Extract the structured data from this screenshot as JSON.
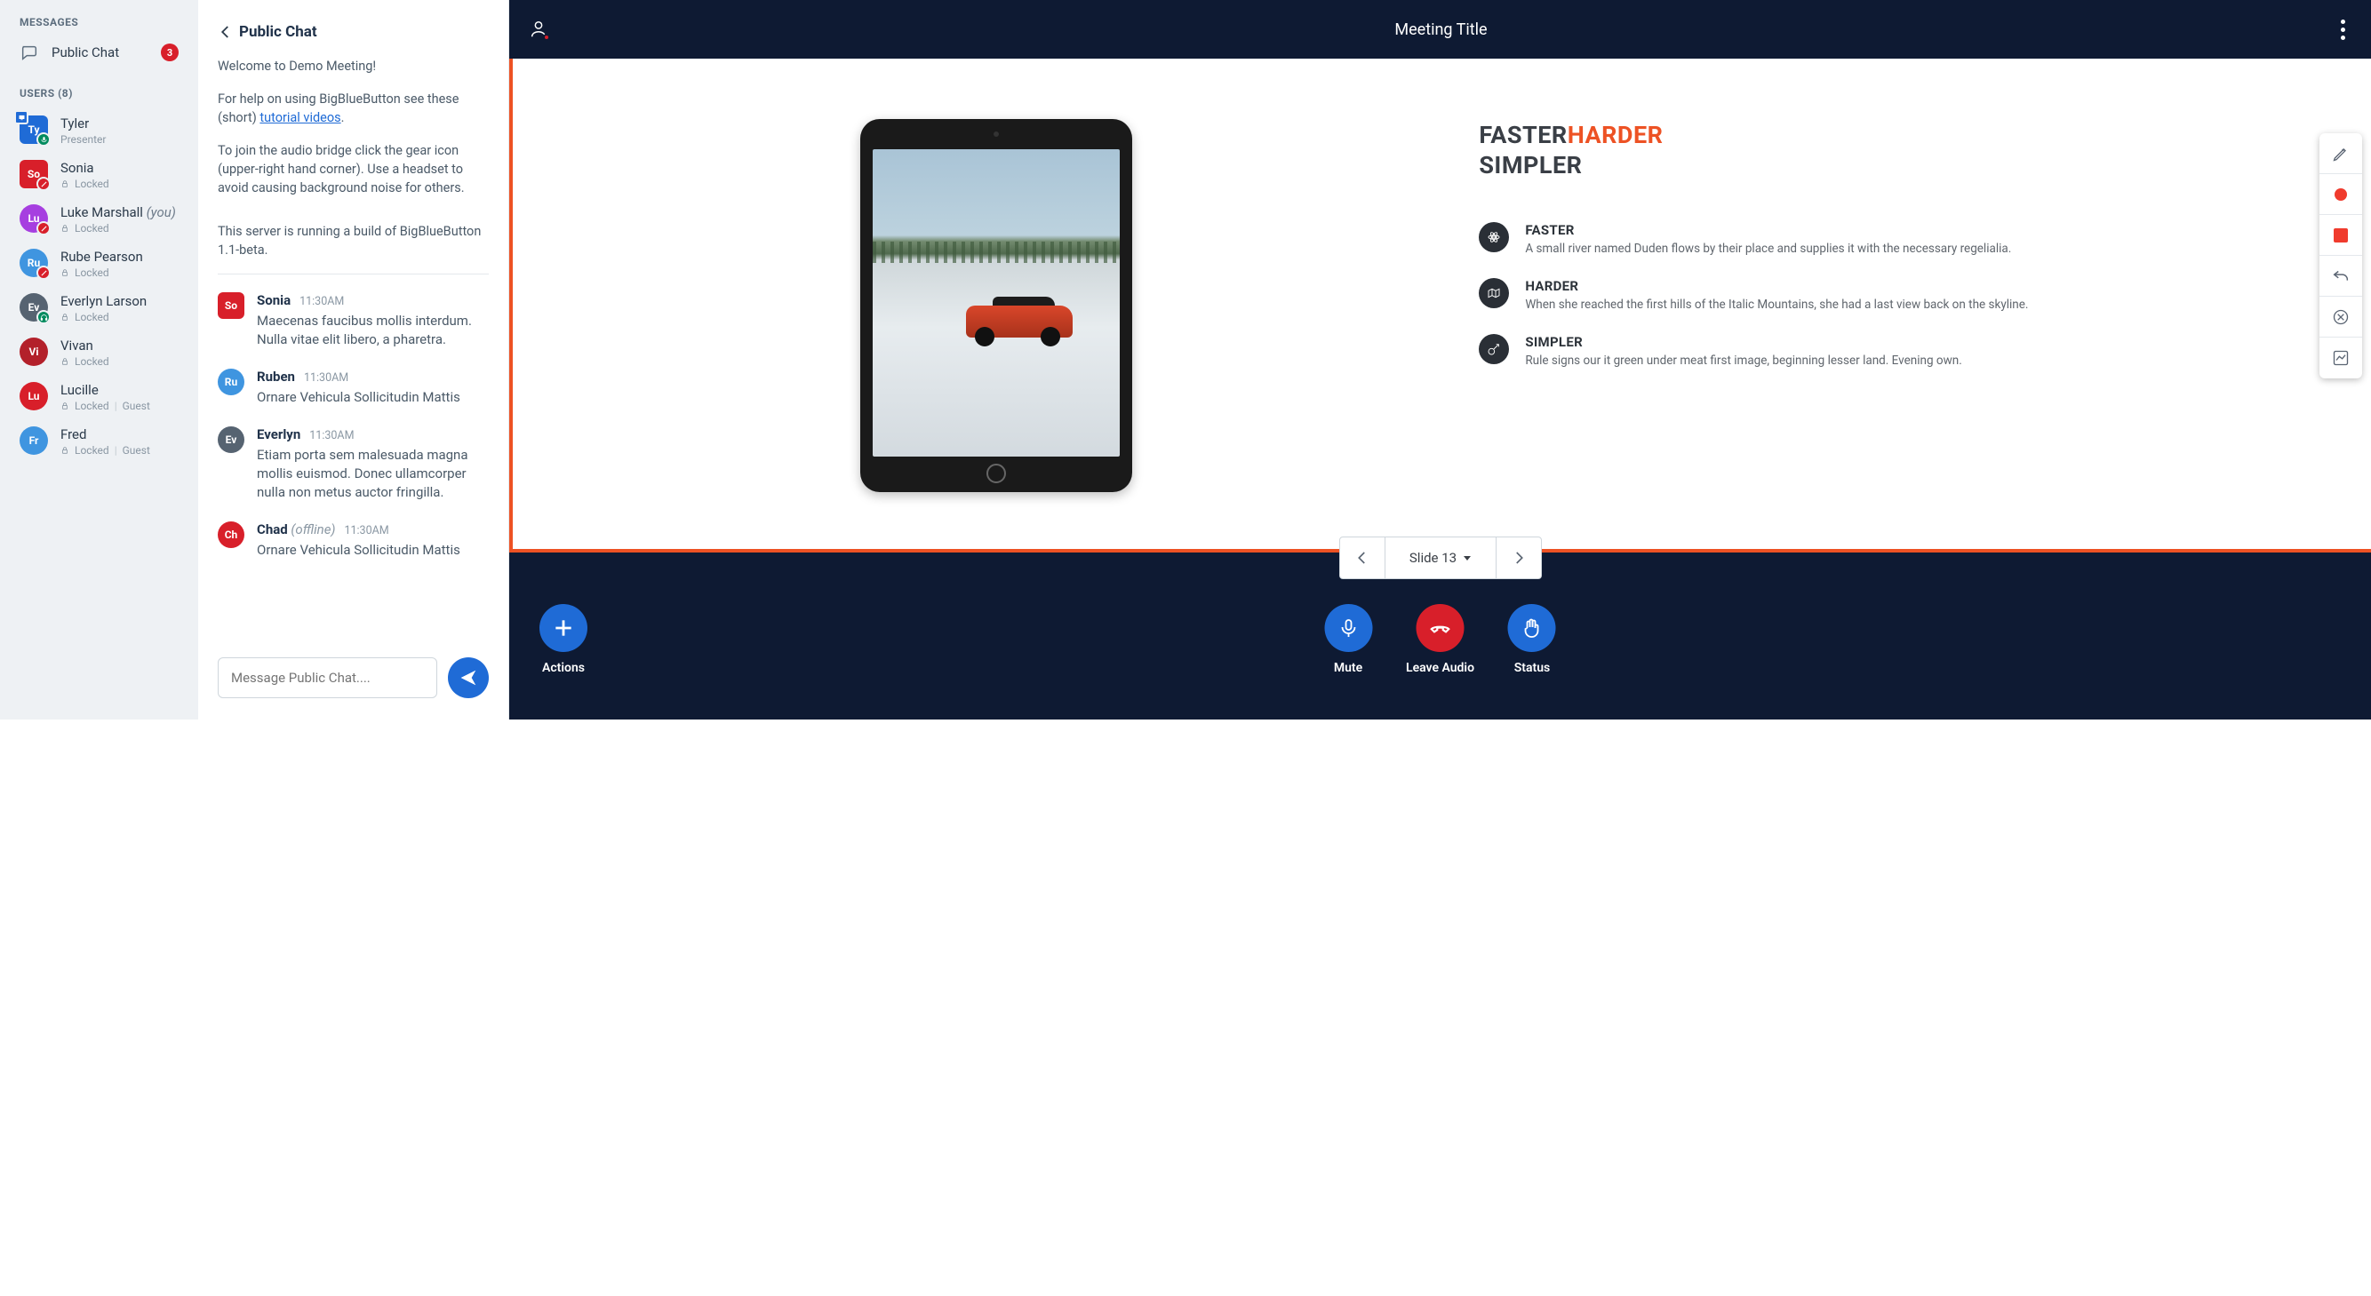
{
  "sidebar": {
    "messagesLabel": "MESSAGES",
    "publicChat": "Public Chat",
    "badge": "3",
    "usersLabel": "USERS (8)",
    "users": [
      {
        "initials": "Ty",
        "name": "Tyler",
        "sub": "Presenter",
        "color": "c-blue",
        "shape": "av-square",
        "presenter": true,
        "status": "green",
        "lock": false,
        "guest": false,
        "you": false
      },
      {
        "initials": "So",
        "name": "Sonia",
        "sub": "Locked",
        "color": "c-red",
        "shape": "av-square",
        "presenter": false,
        "status": "red",
        "lock": true,
        "guest": false,
        "you": false
      },
      {
        "initials": "Lu",
        "name": "Luke Marshall",
        "sub": "Locked",
        "color": "c-purple",
        "shape": "",
        "presenter": false,
        "status": "red",
        "lock": true,
        "guest": false,
        "you": true
      },
      {
        "initials": "Ru",
        "name": "Rube Pearson",
        "sub": "Locked",
        "color": "c-lblue",
        "shape": "",
        "presenter": false,
        "status": "red",
        "lock": true,
        "guest": false,
        "you": false
      },
      {
        "initials": "Ev",
        "name": "Everlyn Larson",
        "sub": "Locked",
        "color": "c-grey",
        "shape": "",
        "presenter": false,
        "status": "green",
        "lock": true,
        "guest": false,
        "you": false
      },
      {
        "initials": "Vi",
        "name": "Vivan",
        "sub": "Locked",
        "color": "c-dred",
        "shape": "",
        "presenter": false,
        "status": "",
        "lock": true,
        "guest": false,
        "you": false
      },
      {
        "initials": "Lu",
        "name": "Lucille",
        "sub": "Locked",
        "color": "c-red",
        "shape": "",
        "presenter": false,
        "status": "",
        "lock": true,
        "guest": true,
        "you": false
      },
      {
        "initials": "Fr",
        "name": "Fred",
        "sub": "Locked",
        "color": "c-lblue",
        "shape": "",
        "presenter": false,
        "status": "",
        "lock": true,
        "guest": true,
        "you": false
      }
    ],
    "youLabel": "(you)",
    "guestLabel": "Guest"
  },
  "chat": {
    "title": "Public Chat",
    "welcome": [
      "Welcome to Demo Meeting!",
      "For help on using BigBlueButton see these (short) tutorial videos.",
      "To join the audio bridge click the gear icon (upper-right hand corner). Use a headset to avoid causing background noise for others.",
      "This server is running a build of BigBlueButton 1.1-beta."
    ],
    "linkWord": "tutorial videos",
    "messages": [
      {
        "initials": "So",
        "color": "c-red",
        "shape": "av-square",
        "name": "Sonia",
        "offline": false,
        "time": "11:30AM",
        "text": "Maecenas faucibus mollis interdum. Nulla vitae elit libero, a pharetra."
      },
      {
        "initials": "Ru",
        "color": "c-lblue",
        "shape": "",
        "name": "Ruben",
        "offline": false,
        "time": "11:30AM",
        "text": "Ornare Vehicula Sollicitudin Mattis"
      },
      {
        "initials": "Ev",
        "color": "c-grey",
        "shape": "",
        "name": "Everlyn",
        "offline": false,
        "time": "11:30AM",
        "text": "Etiam porta sem malesuada magna mollis euismod. Donec ullamcorper nulla non metus auctor fringilla."
      },
      {
        "initials": "Ch",
        "color": "c-red",
        "shape": "",
        "name": "Chad",
        "offline": true,
        "time": "11:30AM",
        "text": "Ornare Vehicula Sollicitudin Mattis"
      }
    ],
    "offlineLabel": "(offline)",
    "placeholder": "Message Public Chat...."
  },
  "meeting": {
    "title": "Meeting Title",
    "slogan1": "FASTER",
    "slogan2": "HARDER",
    "slogan3": "SIMPLER",
    "features": [
      {
        "title": "FASTER",
        "body": "A small river named Duden flows by their place and supplies it with the necessary regelialia."
      },
      {
        "title": "HARDER",
        "body": "When she reached the first hills of the Italic Mountains, she had a last view back on the skyline."
      },
      {
        "title": "SIMPLER",
        "body": "Rule signs our it green under meat first image, beginning lesser land. Evening own."
      }
    ],
    "slideLabel": "Slide 13",
    "actions": {
      "actions": "Actions",
      "mute": "Mute",
      "leave": "Leave Audio",
      "status": "Status"
    }
  }
}
